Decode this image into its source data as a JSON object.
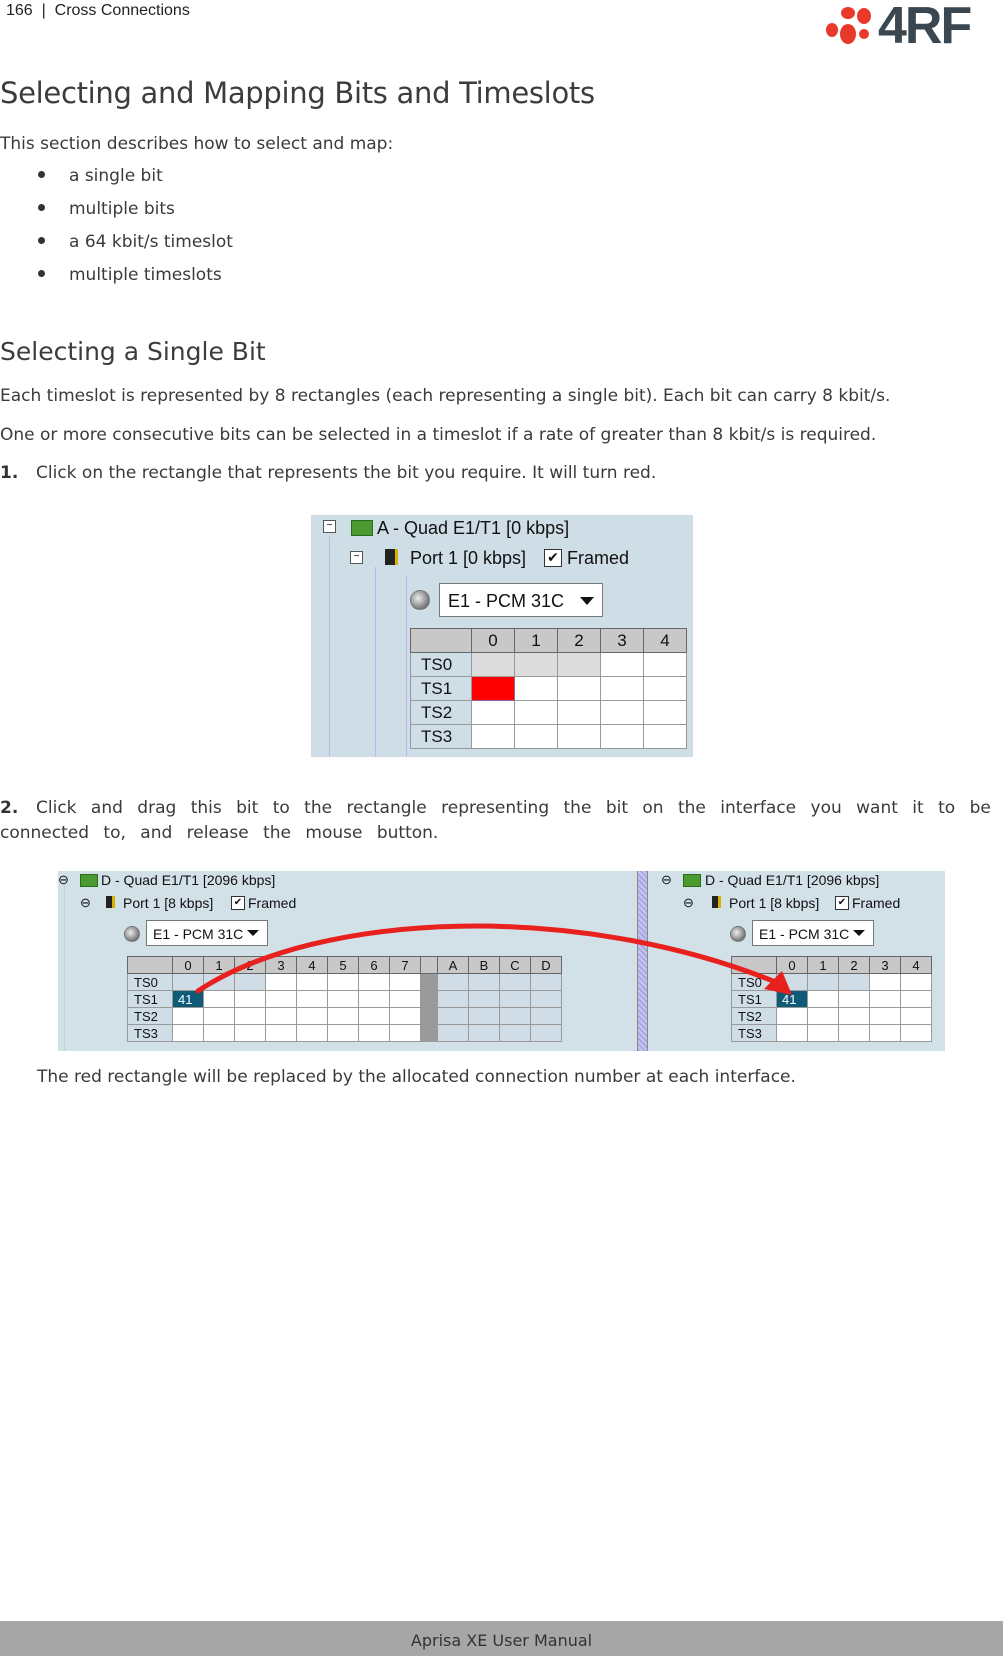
{
  "header": {
    "page_number": "166",
    "separator": "|",
    "section": "Cross Connections"
  },
  "logo": {
    "text": "4RF",
    "dot_color": "#e8392b",
    "text_color": "#3a4750"
  },
  "title": "Selecting and Mapping Bits and Timeslots",
  "intro": "This section describes how to select and map:",
  "bullets": [
    "a single bit",
    "multiple bits",
    "a 64 kbit/s timeslot",
    "multiple timeslots"
  ],
  "subsection": {
    "title": "Selecting a Single Bit",
    "para1": "Each timeslot is represented by 8 rectangles (each representing a single bit). Each bit can carry 8 kbit/s.",
    "para2": "One or more consecutive bits can be selected in a timeslot if a rate of greater than 8 kbit/s is required.",
    "steps": [
      {
        "num": "1.",
        "text": "Click on the rectangle that represents the bit you require. It will turn red."
      },
      {
        "num": "2.",
        "text": "Click and drag this bit to the rectangle representing the bit on the interface you want it to be connected to, and release the mouse button."
      }
    ],
    "note": "The red rectangle will be replaced by the allocated connection number at each interface."
  },
  "screenshot1": {
    "module": "A - Quad E1/T1 [0 kbps]",
    "port": "Port 1 [0 kbps]",
    "framed_label": "Framed",
    "framed_checked": true,
    "mode": "E1 - PCM 31C",
    "columns": [
      "0",
      "1",
      "2",
      "3",
      "4"
    ],
    "rows": [
      "TS0",
      "TS1",
      "TS2",
      "TS3"
    ],
    "selected_cell": {
      "row": "TS1",
      "col": "0",
      "color": "#ff0000"
    }
  },
  "screenshot2": {
    "left": {
      "module": "D - Quad E1/T1 [2096 kbps]",
      "port": "Port 1 [8 kbps]",
      "framed_label": "Framed",
      "mode": "E1 - PCM 31C",
      "columns": [
        "0",
        "1",
        "2",
        "3",
        "4",
        "5",
        "6",
        "7",
        "",
        "A",
        "B",
        "C",
        "D"
      ],
      "rows": [
        "TS0",
        "TS1",
        "TS2",
        "TS3"
      ],
      "connection": {
        "row": "TS1",
        "col": "0",
        "value": "41"
      }
    },
    "right": {
      "module": "D - Quad E1/T1 [2096 kbps]",
      "port": "Port 1 [8 kbps]",
      "framed_label": "Framed",
      "mode": "E1 - PCM 31C",
      "columns": [
        "0",
        "1",
        "2",
        "3",
        "4"
      ],
      "rows": [
        "TS0",
        "TS1",
        "TS2",
        "TS3"
      ],
      "connection": {
        "row": "TS1",
        "col": "0",
        "value": "41"
      }
    },
    "arrow_color": "#e8201e"
  },
  "footer": "Aprisa XE User Manual"
}
